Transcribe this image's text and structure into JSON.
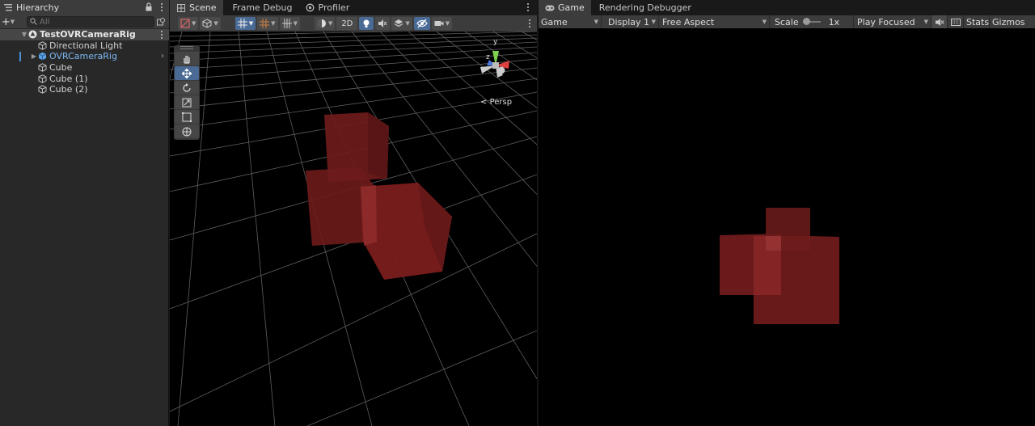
{
  "hierarchy": {
    "tab_label": "Hierarchy",
    "add_label": "+",
    "search_placeholder": "All",
    "items": [
      {
        "label": "TestOVRCameraRig"
      },
      {
        "label": "Directional Light"
      },
      {
        "label": "OVRCameraRig"
      },
      {
        "label": "Cube"
      },
      {
        "label": "Cube (1)"
      },
      {
        "label": "Cube (2)"
      }
    ]
  },
  "scene": {
    "tabs": [
      {
        "label": "Scene"
      },
      {
        "label": "Frame Debug"
      },
      {
        "label": "Profiler"
      }
    ],
    "toolbar": {
      "mode_2d": "2D"
    },
    "persp_label": "Persp",
    "gizmo_axes": {
      "y": "y",
      "z": "z"
    },
    "tool_icons": [
      "hand-icon",
      "move-icon",
      "rotate-icon",
      "scale-icon",
      "rect-icon",
      "transform-icon"
    ]
  },
  "game": {
    "tabs": [
      {
        "label": "Game"
      },
      {
        "label": "Rendering Debugger"
      }
    ],
    "toolbar": {
      "view_select": "Game",
      "display_select": "Display 1",
      "aspect_select": "Free Aspect",
      "scale_label": "Scale",
      "scale_value": "1x",
      "play_mode": "Play Focused",
      "stats_label": "Stats",
      "gizmos_label": "Gizmos"
    }
  },
  "colors": {
    "cube_red": "#7a1c1c",
    "panel_bg": "#282828",
    "toolbar_bg": "#3c3c3c",
    "accent_blue": "#4a6a96",
    "selected_text": "#7cb8f0"
  }
}
